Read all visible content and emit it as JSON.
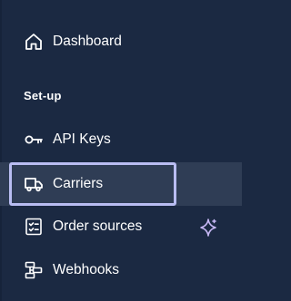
{
  "nav": {
    "dashboard": {
      "label": "Dashboard",
      "icon": "home-icon"
    },
    "section_setup": "Set-up",
    "api_keys": {
      "label": "API Keys",
      "icon": "key-icon"
    },
    "carriers": {
      "label": "Carriers",
      "icon": "truck-icon",
      "active": true
    },
    "order_sources": {
      "label": "Order sources",
      "icon": "checklist-icon",
      "badge_icon": "sparkle-icon"
    },
    "webhooks": {
      "label": "Webhooks",
      "icon": "webhook-icon"
    }
  },
  "colors": {
    "background": "#1b2942",
    "active_background": "#2f3d55",
    "focus_ring": "#b9bdf2",
    "text": "#ffffff",
    "sparkle": "#c7b8f5"
  }
}
